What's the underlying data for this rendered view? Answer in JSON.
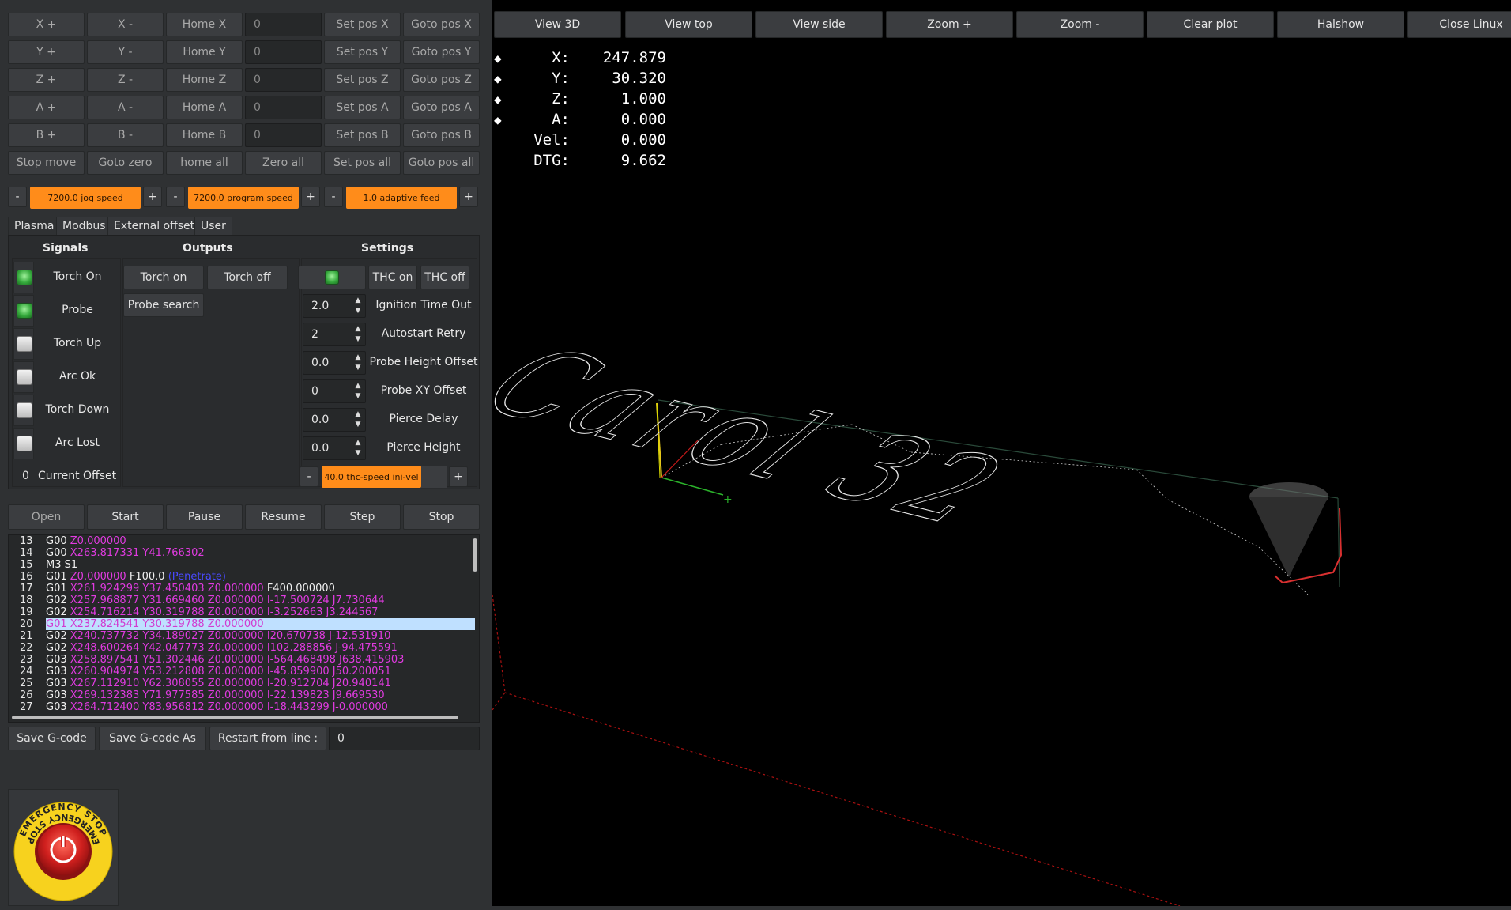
{
  "jog": {
    "rows": [
      {
        "plus": "X +",
        "minus": "X -",
        "home": "Home X",
        "value": "0",
        "setpos": "Set pos X",
        "goto": "Goto pos X"
      },
      {
        "plus": "Y +",
        "minus": "Y -",
        "home": "Home Y",
        "value": "0",
        "setpos": "Set pos Y",
        "goto": "Goto pos Y"
      },
      {
        "plus": "Z +",
        "minus": "Z -",
        "home": "Home Z",
        "value": "0",
        "setpos": "Set pos Z",
        "goto": "Goto pos Z"
      },
      {
        "plus": "A +",
        "minus": "A -",
        "home": "Home A",
        "value": "0",
        "setpos": "Set pos A",
        "goto": "Goto pos A"
      },
      {
        "plus": "B +",
        "minus": "B -",
        "home": "Home B",
        "value": "0",
        "setpos": "Set pos B",
        "goto": "Goto pos B"
      }
    ],
    "bottom": {
      "stop": "Stop move",
      "goto_zero": "Goto zero",
      "home_all": "home all",
      "zero_all": "Zero all",
      "set_pos_all": "Set pos all",
      "goto_pos_all": "Goto pos all"
    }
  },
  "speeds": {
    "minus": "-",
    "plus": "+",
    "jog": "7200.0 jog speed",
    "program": "7200.0 program speed",
    "adaptive": "1.0 adaptive feed"
  },
  "tabs": [
    "Plasma",
    "Modbus",
    "External offset",
    "User"
  ],
  "plasma": {
    "signals_title": "Signals",
    "outputs_title": "Outputs",
    "settings_title": "Settings",
    "signals": [
      {
        "label": "Torch On",
        "state": "on"
      },
      {
        "label": "Probe",
        "state": "on"
      },
      {
        "label": "Torch Up",
        "state": "off"
      },
      {
        "label": "Arc Ok",
        "state": "off"
      },
      {
        "label": "Torch Down",
        "state": "off"
      },
      {
        "label": "Arc Lost",
        "state": "off"
      }
    ],
    "current_offset_value": "0",
    "current_offset_label": "Current Offset",
    "outputs": {
      "torch_on": "Torch on",
      "torch_off": "Torch off",
      "probe_search": "Probe search"
    },
    "thc": {
      "on": "THC on",
      "off": "THC off"
    },
    "settings": [
      {
        "value": "2.0",
        "label": "Ignition Time Out"
      },
      {
        "value": "2",
        "label": "Autostart Retry"
      },
      {
        "value": "0.0",
        "label": "Probe Height Offset"
      },
      {
        "value": "0",
        "label": "Probe XY Offset"
      },
      {
        "value": "0.0",
        "label": "Pierce Delay"
      },
      {
        "value": "0.0",
        "label": "Pierce Height"
      }
    ],
    "thc_speed": "40.0 thc-speed ini-vel"
  },
  "program": {
    "open": "Open",
    "start": "Start",
    "pause": "Pause",
    "resume": "Resume",
    "step": "Step",
    "stop": "Stop"
  },
  "gcode": [
    {
      "n": "13",
      "cmd": "G00",
      "args": "Z0.000000",
      "extra": "",
      "comment": ""
    },
    {
      "n": "14",
      "cmd": "G00",
      "args": "X263.817331 Y41.766302",
      "extra": "",
      "comment": ""
    },
    {
      "n": "15",
      "cmd": "M3 S1",
      "args": "",
      "extra": "",
      "comment": ""
    },
    {
      "n": "16",
      "cmd": "G01",
      "args": "Z0.000000",
      "extra": "F100.0",
      "comment": "(Penetrate)"
    },
    {
      "n": "17",
      "cmd": "G01",
      "args": "X261.924299 Y37.450403 Z0.000000",
      "extra": "F400.000000",
      "comment": ""
    },
    {
      "n": "18",
      "cmd": "G02",
      "args": "X257.968877 Y31.669460 Z0.000000 I-17.500724 J7.730644",
      "extra": "",
      "comment": ""
    },
    {
      "n": "19",
      "cmd": "G02",
      "args": "X254.716214 Y30.319788 Z0.000000 I-3.252663 J3.244567",
      "extra": "",
      "comment": ""
    },
    {
      "n": "20",
      "cmd": "G01",
      "args": "X237.824541 Y30.319788 Z0.000000",
      "extra": "",
      "comment": "",
      "selected": true
    },
    {
      "n": "21",
      "cmd": "G02",
      "args": "X240.737732 Y34.189027 Z0.000000 I20.670738 J-12.531910",
      "extra": "",
      "comment": ""
    },
    {
      "n": "22",
      "cmd": "G02",
      "args": "X248.600264 Y42.047773 Z0.000000 I102.288856 J-94.475591",
      "extra": "",
      "comment": ""
    },
    {
      "n": "23",
      "cmd": "G03",
      "args": "X258.897541 Y51.302446 Z0.000000 I-564.468498 J638.415903",
      "extra": "",
      "comment": ""
    },
    {
      "n": "24",
      "cmd": "G03",
      "args": "X260.904974 Y53.212808 Z0.000000 I-45.859900 J50.200051",
      "extra": "",
      "comment": ""
    },
    {
      "n": "25",
      "cmd": "G03",
      "args": "X267.112910 Y62.308055 Z0.000000 I-20.912704 J20.940141",
      "extra": "",
      "comment": ""
    },
    {
      "n": "26",
      "cmd": "G03",
      "args": "X269.132383 Y71.977585 Z0.000000 I-22.139823 J9.669530",
      "extra": "",
      "comment": ""
    },
    {
      "n": "27",
      "cmd": "G03",
      "args": "X264.712400 Y83.956812 Z0.000000 I-18.443299 J-0.000000",
      "extra": "",
      "comment": ""
    }
  ],
  "file": {
    "save": "Save G-code",
    "save_as": "Save G-code As",
    "restart_label": "Restart from line :",
    "restart_value": "0"
  },
  "estop": {
    "text": "EMERGENCY STOP"
  },
  "toolbar": [
    "View 3D",
    "View top",
    "View side",
    "Zoom +",
    "Zoom -",
    "Clear plot",
    "Halshow",
    "Close Linux"
  ],
  "dro": [
    {
      "label": "X:",
      "value": "247.879",
      "marker": true
    },
    {
      "label": "Y:",
      "value": "30.320",
      "marker": true
    },
    {
      "label": "Z:",
      "value": "1.000",
      "marker": true
    },
    {
      "label": "A:",
      "value": "0.000",
      "marker": true
    },
    {
      "label": "Vel:",
      "value": "0.000",
      "marker": false
    },
    {
      "label": "DTG:",
      "value": "9.662",
      "marker": false
    }
  ],
  "preview": {
    "text": "Carol 32"
  },
  "colors": {
    "accent": "#ff8c1a",
    "led_on": "#34a83b",
    "gcode_coords": "#e03be0",
    "gcode_comment": "#4a4aff",
    "selection": "#bfe0ff"
  }
}
